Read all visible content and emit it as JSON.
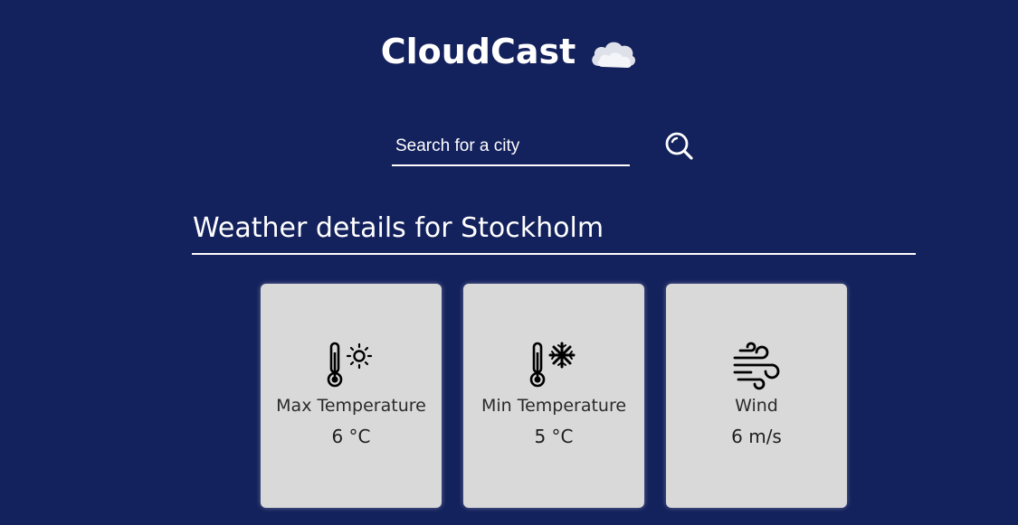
{
  "app": {
    "title": "CloudCast",
    "logo_icon": "cloud-icon"
  },
  "search": {
    "placeholder": "Search for a city",
    "value": "",
    "button_icon": "magnifier-icon"
  },
  "details": {
    "title": "Weather details for Stockholm"
  },
  "cards": [
    {
      "icon": "thermometer-sun-icon",
      "label": "Max Temperature",
      "value": "6 °C"
    },
    {
      "icon": "thermometer-snowflake-icon",
      "label": "Min Temperature",
      "value": "5 °C"
    },
    {
      "icon": "wind-icon",
      "label": "Wind",
      "value": "6 m/s"
    }
  ],
  "colors": {
    "background": "#13215c",
    "card": "#d9d9d9",
    "text_light": "#ffffff",
    "text_dark": "#2a2a2a"
  }
}
